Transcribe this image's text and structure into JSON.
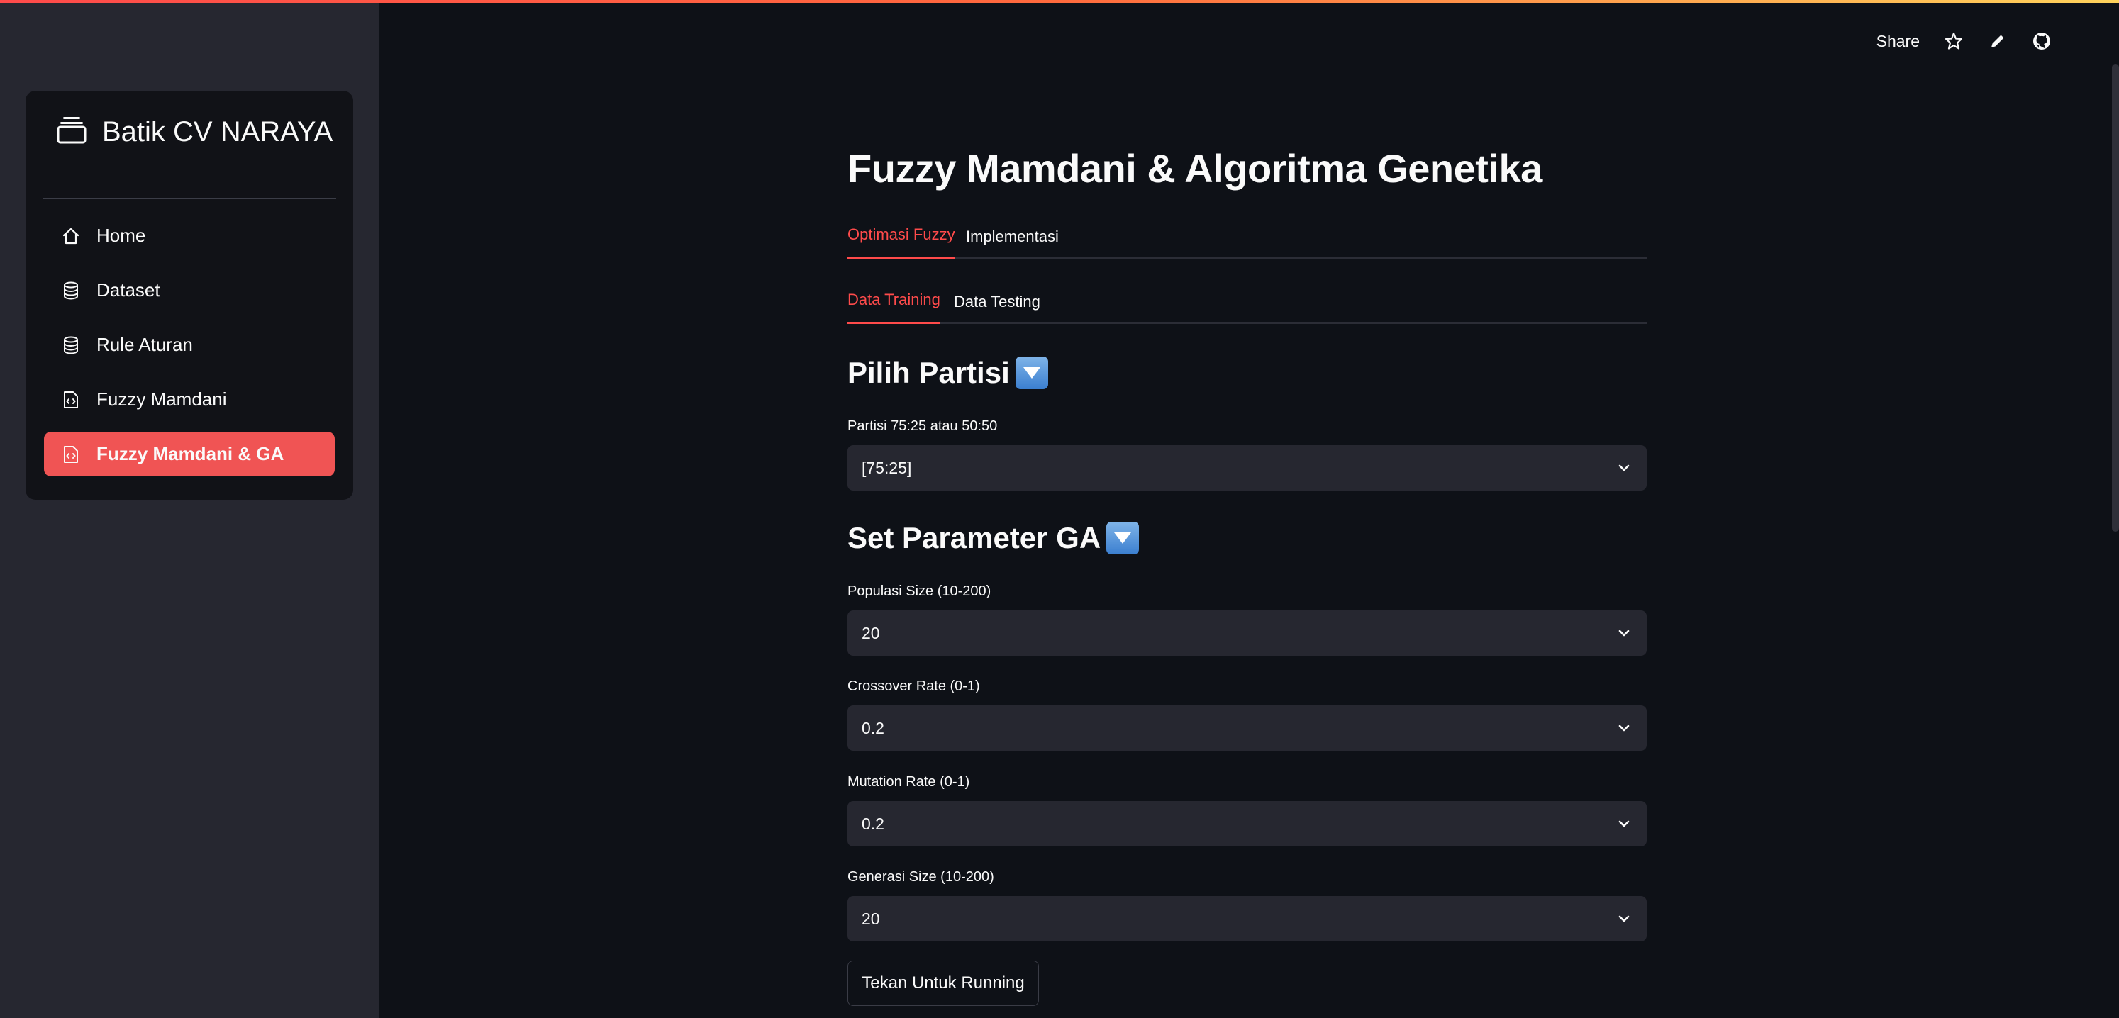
{
  "sidebar": {
    "brand": "Batik CV NARAYA",
    "items": [
      {
        "label": "Home",
        "icon": "home-icon"
      },
      {
        "label": "Dataset",
        "icon": "database-icon"
      },
      {
        "label": "Rule Aturan",
        "icon": "database-icon"
      },
      {
        "label": "Fuzzy Mamdani",
        "icon": "code-file-icon"
      },
      {
        "label": "Fuzzy Mamdani & GA",
        "icon": "code-file-icon",
        "active": true
      }
    ]
  },
  "toolbar": {
    "share_label": "Share",
    "icons": [
      "star-icon",
      "pencil-icon",
      "github-icon"
    ]
  },
  "main": {
    "title": "Fuzzy Mamdani & Algoritma Genetika",
    "tabs": [
      {
        "label": "Optimasi Fuzzy",
        "active": true
      },
      {
        "label": "Implementasi",
        "active": false
      }
    ],
    "subtabs": [
      {
        "label": "Data Training",
        "active": true
      },
      {
        "label": "Data Testing",
        "active": false
      }
    ],
    "partisi_section": {
      "heading": "Pilih Partisi",
      "field_label": "Partisi 75:25 atau 50:50",
      "value": "[75:25]"
    },
    "ga_section": {
      "heading": "Set Parameter GA",
      "fields": [
        {
          "label": "Populasi Size (10-200)",
          "value": "20"
        },
        {
          "label": "Crossover Rate (0-1)",
          "value": "0.2"
        },
        {
          "label": "Mutation Rate (0-1)",
          "value": "0.2"
        },
        {
          "label": "Generasi Size (10-200)",
          "value": "20"
        }
      ]
    },
    "run_button_label": "Tekan Untuk Running"
  },
  "colors": {
    "accent": "#ff4b4b",
    "active_menu": "#f05454",
    "background": "#0e1117",
    "sidebar": "#262730",
    "input": "#262730"
  }
}
